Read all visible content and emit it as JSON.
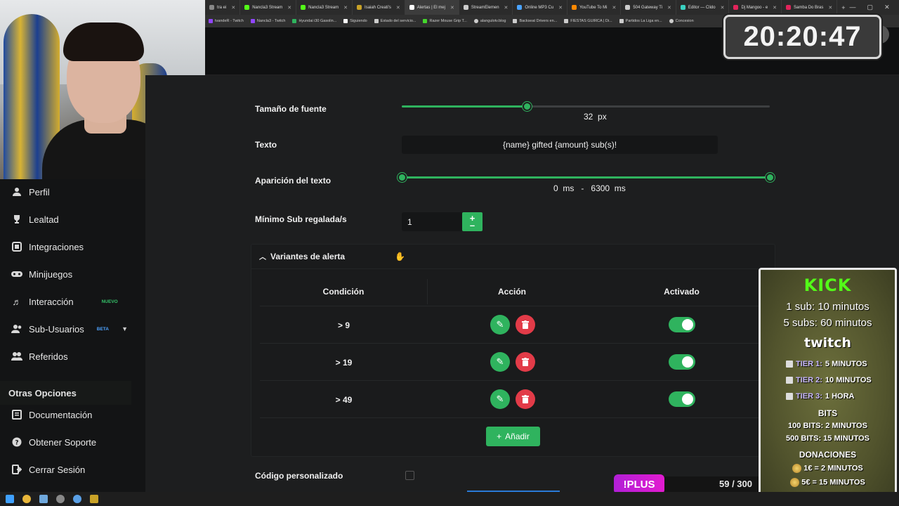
{
  "browser": {
    "tabs": [
      {
        "label": "tra ei",
        "color": "#888888"
      },
      {
        "label": "Nancla3 Stream",
        "color": "#53fc18"
      },
      {
        "label": "Nancla3 Stream",
        "color": "#53fc18"
      },
      {
        "label": "Isaiah Creati's",
        "color": "#c9a227"
      },
      {
        "label": "Alertas | El mej",
        "color": "#ffffff"
      },
      {
        "label": "StreamElemen",
        "color": "#cccccc"
      },
      {
        "label": "Online MP3 Cu",
        "color": "#4aa3ff"
      },
      {
        "label": "YouTube To Mi",
        "color": "#ff8800"
      },
      {
        "label": "504 Gateway Ti",
        "color": "#cccccc"
      },
      {
        "label": "Editor — Clido",
        "color": "#3ad1c1"
      },
      {
        "label": "Dj Mangoo - e",
        "color": "#e2245b"
      },
      {
        "label": "Samba Do Bras",
        "color": "#e2245b"
      }
    ],
    "bookmarks": [
      {
        "label": "tvandeR - Twitch",
        "color": "#9146ff"
      },
      {
        "label": "Nancla3 - Twitch",
        "color": "#9146ff"
      },
      {
        "label": "Hyundai i30 Gasolin...",
        "color": "#2fb35e"
      },
      {
        "label": "Siguiendo",
        "color": "#ffffff"
      },
      {
        "label": "Estado del servicio...",
        "color": "#cccccc"
      },
      {
        "label": "Razer Mouse Grip T...",
        "color": "#44d62c"
      },
      {
        "label": "alangulotv.blog",
        "color": "#cccccc"
      },
      {
        "label": "Backseat Drivers en...",
        "color": "#cccccc"
      },
      {
        "label": "FIESTAS GUIRCA | Di...",
        "color": "#cccccc"
      },
      {
        "label": "Partidos La Liga en...",
        "color": "#cccccc"
      },
      {
        "label": "Concesion",
        "color": "#cccccc"
      }
    ]
  },
  "timer": "20:20:47",
  "sidebar": {
    "items": [
      {
        "label": "Perfil",
        "icon": "user-icon"
      },
      {
        "label": "Lealtad",
        "icon": "trophy-icon"
      },
      {
        "label": "Integraciones",
        "icon": "integrations-icon"
      },
      {
        "label": "Minijuegos",
        "icon": "gamepad-icon"
      },
      {
        "label": "Interacción",
        "icon": "music-icon",
        "badge": "NUEVO"
      },
      {
        "label": "Sub-Usuarios",
        "icon": "users-icon",
        "badge": "BETA"
      },
      {
        "label": "Referidos",
        "icon": "referrals-icon"
      }
    ],
    "section_title": "Otras Opciones",
    "other_items": [
      {
        "label": "Documentación",
        "icon": "document-icon"
      },
      {
        "label": "Obtener Soporte",
        "icon": "help-icon"
      },
      {
        "label": "Cerrar Sesión",
        "icon": "logout-icon"
      }
    ]
  },
  "settings": {
    "font_size": {
      "label": "Tamaño de fuente",
      "value": "32",
      "unit": "px",
      "fraction": 0.34
    },
    "text": {
      "label": "Texto",
      "value": "{name} gifted {amount} sub(s)!"
    },
    "appearance": {
      "label": "Aparición del texto",
      "from": "0",
      "to": "6300",
      "unit": "ms",
      "separator": "-"
    },
    "min_subs": {
      "label": "Mínimo Sub regalada/s",
      "value": "1",
      "plus": "+",
      "minus": "–"
    }
  },
  "variants": {
    "title": "Variantes de alerta",
    "columns": [
      "Condición",
      "Acción",
      "Activado"
    ],
    "rows": [
      {
        "condition": "> 9",
        "enabled": true
      },
      {
        "condition": "> 19",
        "enabled": true
      },
      {
        "condition": "> 49",
        "enabled": true
      }
    ],
    "add_label": "Añadir"
  },
  "custom_code": {
    "label": "Código personalizado",
    "checked": false
  },
  "overlay": {
    "kick_logo": "KICK",
    "kick_line1": "1 sub: 10 minutos",
    "kick_line2": "5 subs: 60 minutos",
    "twitch_logo": "twitch",
    "tiers": [
      {
        "name": "TIER 1:",
        "value": "5 MINUTOS"
      },
      {
        "name": "TIER 2:",
        "value": "10 MINUTOS"
      },
      {
        "name": "TIER 3:",
        "value": "1 HORA"
      }
    ],
    "bits_title": "BITS",
    "bits_1": "100 BITS: 2 MINUTOS",
    "bits_2": "500 BITS: 15 MINUTOS",
    "donations_title": "DONACIONES",
    "donation_1": "1€ = 2 MINUTOS",
    "donation_2": "5€ = 15 MINUTOS"
  },
  "plus_label": "!PLUS",
  "counter": "59 / 300",
  "colors": {
    "accent": "#2fb35e",
    "danger": "#e23b48",
    "kick": "#53fc18",
    "plus": "#c61ed6"
  }
}
